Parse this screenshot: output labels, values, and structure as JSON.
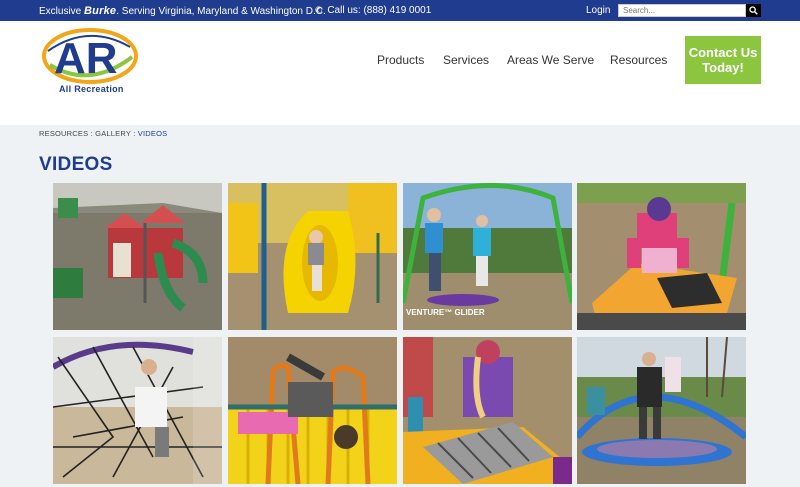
{
  "topbar": {
    "exclusive_prefix": "Exclusive",
    "brand": "Burke",
    "serving_text": ". Serving Virginia, Maryland & Washington D.C.",
    "phone": "Call us: (888) 419 0001",
    "login": "Login",
    "search_placeholder": "Search..."
  },
  "header": {
    "logo_letters": "AR",
    "logo_tagline": "All Recreation",
    "nav": [
      "Products",
      "Services",
      "Areas We Serve",
      "Resources"
    ],
    "cta_line1": "Contact Us",
    "cta_line2": "Today!"
  },
  "breadcrumb": {
    "resources": "RESOURCES",
    "gallery": "GALLERY",
    "current": "VIDEOS",
    "separator": " : "
  },
  "page": {
    "title": "VIDEOS"
  },
  "videos": [
    {
      "caption": ""
    },
    {
      "caption": ""
    },
    {
      "caption": "VENTURE™ GLIDER"
    },
    {
      "caption": ""
    },
    {
      "caption": ""
    },
    {
      "caption": ""
    },
    {
      "caption": ""
    },
    {
      "caption": ""
    }
  ],
  "colors": {
    "brand_blue": "#1f3c8f",
    "cta_green": "#8cc63f",
    "content_bg": "#eef2f5"
  }
}
